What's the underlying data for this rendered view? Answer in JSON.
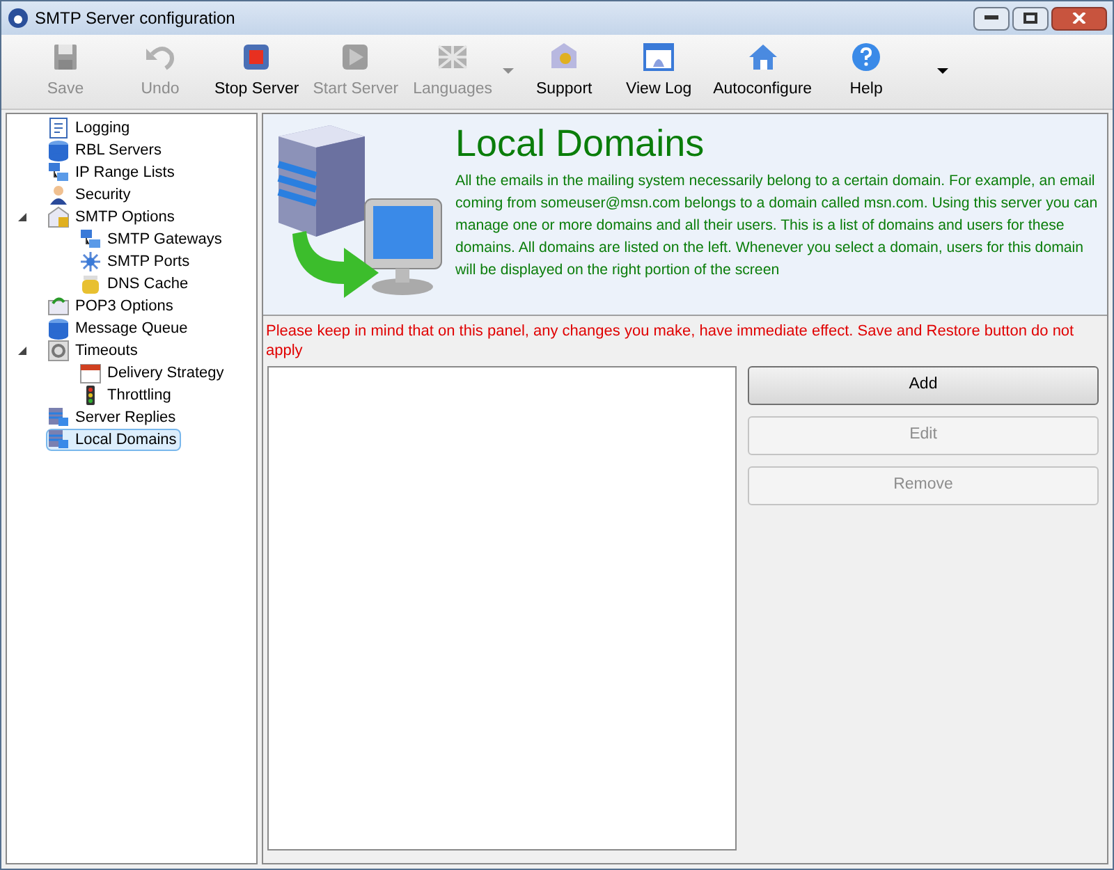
{
  "window": {
    "title": "SMTP Server configuration"
  },
  "toolbar": [
    {
      "label": "Save",
      "kind": "save",
      "disabled": true,
      "dropdown": false
    },
    {
      "label": "Undo",
      "kind": "undo",
      "disabled": true,
      "dropdown": false
    },
    {
      "label": "Stop Server",
      "kind": "stop",
      "disabled": false,
      "dropdown": false
    },
    {
      "label": "Start Server",
      "kind": "start",
      "disabled": true,
      "dropdown": false
    },
    {
      "label": "Languages",
      "kind": "languages",
      "disabled": true,
      "dropdown": true
    },
    {
      "label": "Support",
      "kind": "support",
      "disabled": false,
      "dropdown": false
    },
    {
      "label": "View Log",
      "kind": "log",
      "disabled": false,
      "dropdown": false
    },
    {
      "label": "Autoconfigure",
      "kind": "home",
      "disabled": false,
      "dropdown": false
    },
    {
      "label": "Help",
      "kind": "help",
      "disabled": false,
      "dropdown": false
    }
  ],
  "tree": [
    {
      "label": "Logging",
      "kind": "doc",
      "selected": false
    },
    {
      "label": "RBL Servers",
      "kind": "db",
      "selected": false
    },
    {
      "label": "IP Range Lists",
      "kind": "net",
      "selected": false
    },
    {
      "label": "Security",
      "kind": "user",
      "selected": false
    },
    {
      "label": "SMTP Options",
      "kind": "lock",
      "selected": false,
      "expanded": true,
      "children": [
        {
          "label": "SMTP Gateways",
          "kind": "net",
          "selected": false
        },
        {
          "label": "SMTP Ports",
          "kind": "star",
          "selected": false
        },
        {
          "label": "DNS Cache",
          "kind": "jar",
          "selected": false
        }
      ]
    },
    {
      "label": "POP3 Options",
      "kind": "mail",
      "selected": false
    },
    {
      "label": "Message Queue",
      "kind": "db",
      "selected": false
    },
    {
      "label": "Timeouts",
      "kind": "gear",
      "selected": false,
      "expanded": true,
      "children": [
        {
          "label": "Delivery Strategy",
          "kind": "calendar",
          "selected": false
        },
        {
          "label": "Throttling",
          "kind": "light",
          "selected": false
        }
      ]
    },
    {
      "label": "Server Replies",
      "kind": "server",
      "selected": false
    },
    {
      "label": "Local Domains",
      "kind": "server",
      "selected": true
    }
  ],
  "header": {
    "title": "Local Domains",
    "description": "All the emails in the mailing system necessarily belong to a certain domain. For example, an email coming from someuser@msn.com belongs to a domain called msn.com. Using this server you can manage one or more domains and all their users. This is a list of domains and users for these domains. All domains are listed on the left. Whenever you select a domain, users for this domain will be displayed on the right portion of the screen"
  },
  "warning": "Please keep in mind that on this panel, any changes you make, have immediate effect. Save and Restore button do not apply",
  "buttons": [
    {
      "label": "Add",
      "disabled": false
    },
    {
      "label": "Edit",
      "disabled": true
    },
    {
      "label": "Remove",
      "disabled": true
    }
  ]
}
